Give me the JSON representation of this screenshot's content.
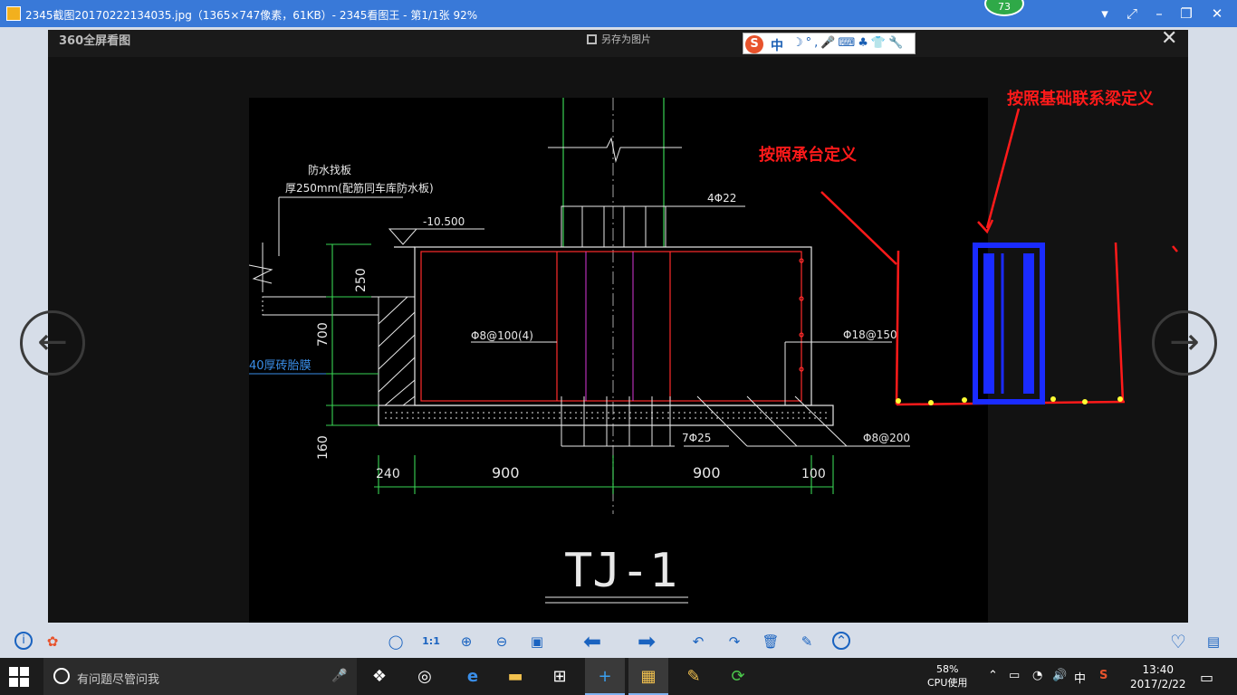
{
  "window": {
    "title": "2345截图20170222134035.jpg（1365×747像素，61KB）- 2345看图王 - 第1/1张 92%",
    "badge": "73",
    "controls": [
      "▾",
      "⤢",
      "–",
      "❐",
      "✕"
    ]
  },
  "viewer": {
    "brand": "360全屏看图",
    "save_as": "另存为图片",
    "close": "✕",
    "prev": "←",
    "next": "→"
  },
  "ime": {
    "logo": "S",
    "mode": "中",
    "tools": "☽°,🎤⌨♣👕🔧"
  },
  "drawing": {
    "title": "TJ-1",
    "labels": {
      "waterproof_board": "防水找板",
      "thickness": "厚250mm(配筋同车库防水板)",
      "elevation": "-10.500",
      "rebar_top": "4Φ22",
      "stirrup": "Φ8@100(4)",
      "side_rebar": "Φ18@150",
      "brick_mold": "40厚砖胎膜",
      "dim_250": "250",
      "dim_700": "700",
      "dim_160": "160",
      "bottom_rebar": "7Φ25",
      "dist_rebar": "Φ8@200",
      "dim_240": "240",
      "dim_900a": "900",
      "dim_900b": "900",
      "dim_100": "100"
    }
  },
  "annotations": {
    "cap": "按照承台定义",
    "beam": "按照基础联系梁定义"
  },
  "toolbar": {
    "info": "i",
    "gift": "✿",
    "items": [
      "◯",
      "1:1",
      "⊕",
      "⊖",
      "▣",
      "⬅",
      "➡",
      "↶",
      "↷",
      "🗑",
      "✎",
      "⌃"
    ],
    "favorite": "♡",
    "folder": "▤"
  },
  "taskbar": {
    "search_placeholder": "有问题尽管问我",
    "mic": "🎤",
    "apps": [
      "❖",
      "◎",
      "e",
      "▬",
      "⊞",
      "+",
      "▦",
      "✎",
      "⟳"
    ],
    "cpu_percent": "58%",
    "cpu_label": "CPU使用",
    "tray": [
      "⌃",
      "▭",
      "◔",
      "🔊",
      "中",
      "S"
    ],
    "time": "13:40",
    "date": "2017/2/22",
    "notify": "▭"
  },
  "colors": {
    "titlebar": "#3979d8",
    "annotation": "#ff1a1a",
    "beam_box": "#1a2bff",
    "cad_green": "#39d353",
    "cad_white": "#e8e8e8",
    "cad_red": "#ff2b2b",
    "cad_magenta": "#d838d8"
  }
}
